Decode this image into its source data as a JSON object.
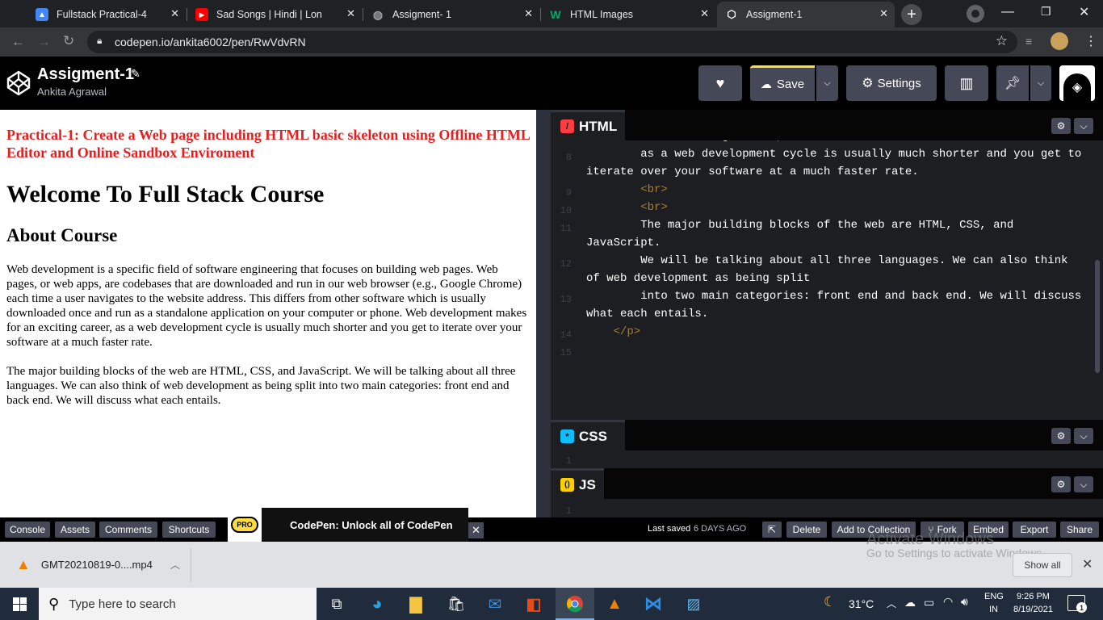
{
  "browser": {
    "tabs": [
      {
        "title": "Fullstack Practical-4",
        "icon": "classroom-icon"
      },
      {
        "title": "Sad Songs | Hindi | Lonely",
        "icon": "youtube-icon"
      },
      {
        "title": "Assigment- 1",
        "icon": "globe-icon"
      },
      {
        "title": "HTML Images",
        "icon": "w3schools-icon"
      },
      {
        "title": "Assigment-1",
        "icon": "codepen-icon",
        "active": true
      }
    ],
    "url": "codepen.io/ankita6002/pen/RwVdvRN"
  },
  "codepen": {
    "pen_title": "Assigment-1",
    "author": "Ankita Agrawal",
    "save_label": "Save",
    "settings_label": "Settings"
  },
  "preview": {
    "practical": "Practical-1: Create a Web page including HTML basic skeleton using Offline HTML Editor and Online Sandbox Enviroment",
    "h1": "Welcome To Full Stack Course",
    "h2": "About Course",
    "p1": "Web development is a specific field of software engineering that focuses on building web pages. Web pages, or web apps, are codebases that are downloaded and run in our web browser (e.g., Google Chrome) each time a user navigates to the website address. This differs from other software which is usually downloaded once and run as a standalone application on your computer or phone. Web development makes for an exciting career, as a web development cycle is usually much shorter and you get to iterate over your software at a much faster rate.",
    "p2": "The major building blocks of the web are HTML, CSS, and JavaScript. We will be talking about all three languages. We can also think of web development as being split into two main categories: front end and back end. We will discuss what each entails."
  },
  "editor": {
    "html_label": "HTML",
    "css_label": "CSS",
    "js_label": "JS",
    "html_lines": [
      {
        "n": "",
        "text": "makes for an exciting career,",
        "cls": "w"
      },
      {
        "n": "8",
        "text": "        as a web development cycle is usually much shorter and you get to",
        "cls": "w"
      },
      {
        "n": "",
        "text": "iterate over your software at a much faster rate.",
        "cls": "w"
      },
      {
        "n": "9",
        "text": "        <br>",
        "cls": "tag"
      },
      {
        "n": "10",
        "text": "        <br>",
        "cls": "tag"
      },
      {
        "n": "11",
        "text": "        The major building blocks of the web are HTML, CSS, and",
        "cls": "w"
      },
      {
        "n": "",
        "text": "JavaScript.",
        "cls": "w"
      },
      {
        "n": "12",
        "text": "        We will be talking about all three languages. We can also think",
        "cls": "w"
      },
      {
        "n": "",
        "text": "of web development as being split",
        "cls": "w"
      },
      {
        "n": "13",
        "text": "        into two main categories: front end and back end. We will discuss",
        "cls": "w"
      },
      {
        "n": "",
        "text": "what each entails.",
        "cls": "w"
      },
      {
        "n": "14",
        "text": "    </p>",
        "cls": "tag"
      },
      {
        "n": "15",
        "text": "",
        "cls": "w"
      }
    ],
    "css_line": "1",
    "js_line": "1"
  },
  "footer": {
    "console": "Console",
    "assets": "Assets",
    "comments": "Comments",
    "shortcuts": "Shortcuts",
    "promo": "CodePen: Unlock all of CodePen",
    "pro_badge": "PRO",
    "last_saved": "Last saved",
    "saved_when": "6 DAYS AGO",
    "delete": "Delete",
    "add_collection": "Add to Collection",
    "fork": "Fork",
    "embed": "Embed",
    "export": "Export",
    "share": "Share"
  },
  "downloads": {
    "file": "GMT20210819-0....mp4",
    "show_all": "Show all",
    "watermark_1": "Activate Windows",
    "watermark_2": "Go to Settings to activate Windows."
  },
  "taskbar": {
    "search_placeholder": "Type here to search",
    "temperature": "31°C",
    "lang_1": "ENG",
    "lang_2": "IN",
    "time": "9:26 PM",
    "date": "8/19/2021",
    "notification_count": "1"
  },
  "colors": {
    "accent_red": "#e81e1e",
    "codepen_bg": "#010101",
    "editor_bg": "#1d1e22",
    "tag_color": "#a88038"
  }
}
